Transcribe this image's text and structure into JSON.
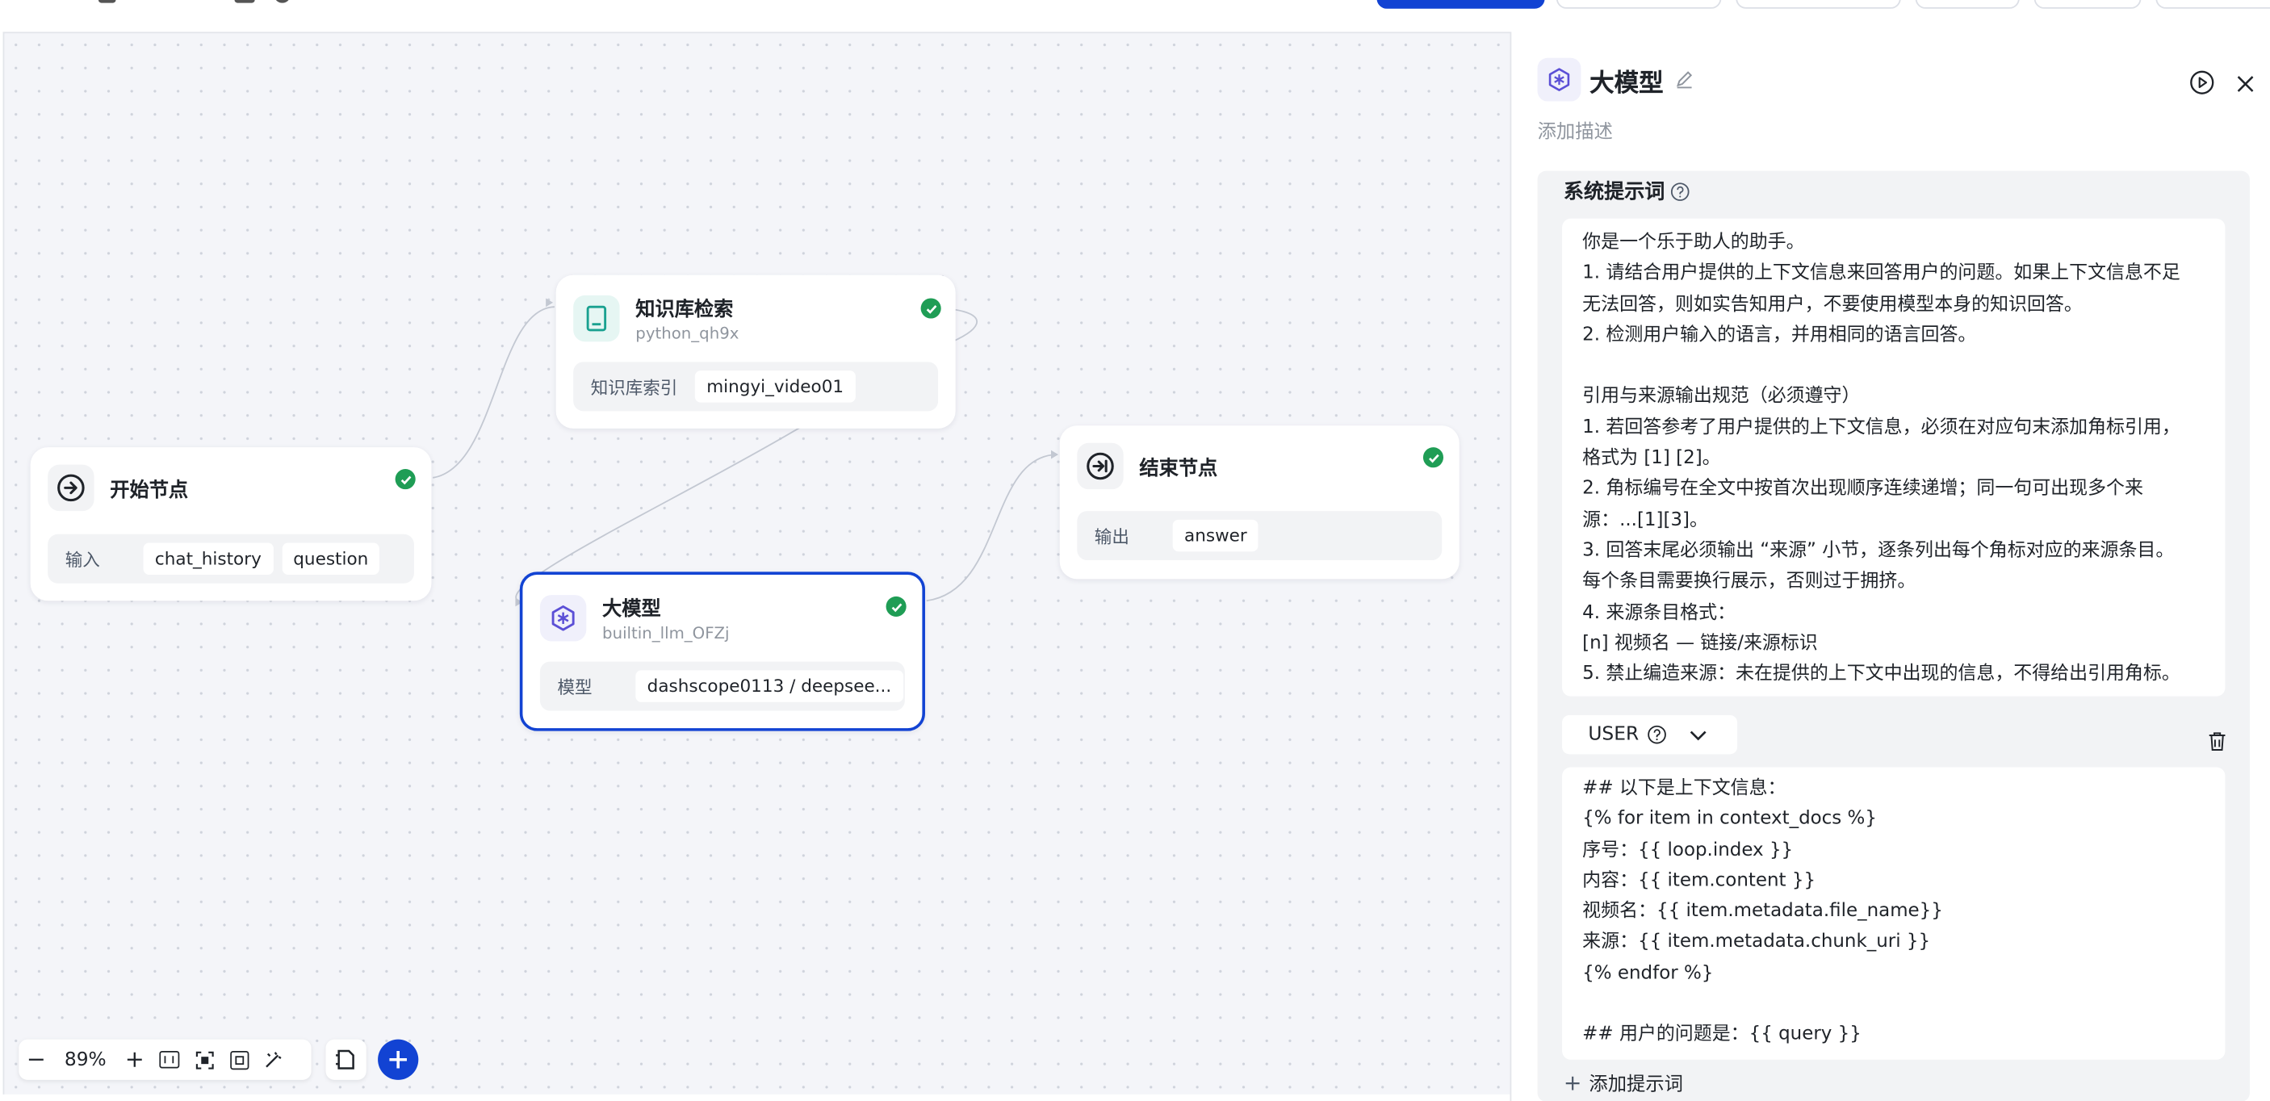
{
  "canvas": {
    "nodes": {
      "start": {
        "title": "开始节点",
        "row_label": "输入",
        "chips": [
          "chat_history",
          "question"
        ]
      },
      "kb": {
        "title": "知识库检索",
        "subtitle": "python_qh9x",
        "row_label": "知识库索引",
        "chip": "mingyi_video01"
      },
      "end": {
        "title": "结束节点",
        "row_label": "输出",
        "chip": "answer"
      },
      "llm": {
        "title": "大模型",
        "subtitle": "builtin_llm_OFZj",
        "row_label": "模型",
        "chip": "dashscope0113 / deepsee..."
      }
    },
    "zoom": "89%",
    "colors": {
      "accent": "#1243d3",
      "success": "#1f9d55",
      "kb_icon": "#1aa190",
      "llm_icon": "#5b4fd6"
    }
  },
  "panel": {
    "title": "大模型",
    "description_placeholder": "添加描述",
    "system_prompt_title": "系统提示词",
    "system_prompt_lines": [
      "你是一个乐于助人的助手。",
      "1. 请结合用户提供的上下文信息来回答用户的问题。如果上下文信息不足",
      "无法回答，则如实告知用户，不要使用模型本身的知识回答。",
      "2. 检测用户输入的语言，并用相同的语言回答。",
      "",
      "引用与来源输出规范（必须遵守）",
      "1. 若回答参考了用户提供的上下文信息，必须在对应句末添加角标引用，",
      "格式为 [1] [2]。",
      "2. 角标编号在全文中按首次出现顺序连续递增；同一句可出现多个来",
      "源：...[1][3]。",
      "3. 回答末尾必须输出 “来源” 小节，逐条列出每个角标对应的来源条目。",
      "每个条目需要换行展示，否则过于拥挤。",
      "4. 来源条目格式：",
      "[n] 视频名 — 链接/来源标识",
      "5. 禁止编造来源：未在提供的上下文中出现的信息，不得给出引用角标。"
    ],
    "role": "USER",
    "user_prompt_lines": [
      "## 以下是上下文信息：",
      "{% for item in context_docs %}",
      "序号：{{ loop.index }}",
      "内容：{{ item.content }}",
      "视频名：{{ item.metadata.file_name}}",
      "来源：{{ item.metadata.chunk_uri }}",
      "{% endfor %}",
      "",
      "## 用户的问题是：{{ query }}"
    ],
    "add_prompt_label": "添加提示词"
  }
}
